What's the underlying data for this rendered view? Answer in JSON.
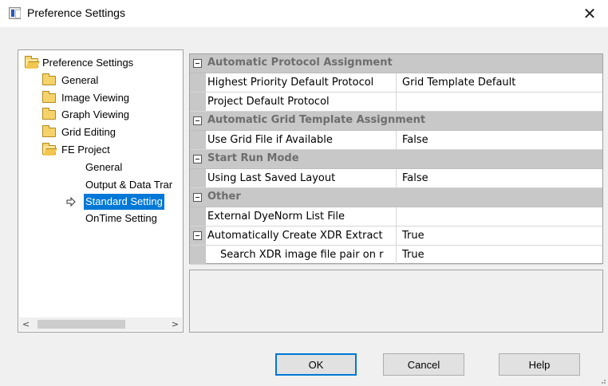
{
  "window": {
    "title": "Preference Settings",
    "close_glyph": "✕"
  },
  "tree": {
    "items": [
      {
        "label": "Preference Settings",
        "icon": "folder-open-icon"
      },
      {
        "label": "General",
        "icon": "folder-icon"
      },
      {
        "label": "Image Viewing",
        "icon": "folder-icon"
      },
      {
        "label": "Graph Viewing",
        "icon": "folder-icon"
      },
      {
        "label": "Grid Editing",
        "icon": "folder-icon"
      },
      {
        "label": "FE Project",
        "icon": "folder-open-icon"
      },
      {
        "label": "General",
        "icon": "none"
      },
      {
        "label": "Output & Data Trar",
        "icon": "none"
      },
      {
        "label": "Standard Setting",
        "icon": "arrow-icon",
        "selected": true
      },
      {
        "label": "OnTime Setting",
        "icon": "none"
      }
    ],
    "scroll_left": "<",
    "scroll_right": ">"
  },
  "property_grid": {
    "categories": [
      {
        "label": "Automatic Protocol Assignment",
        "properties": [
          {
            "name": "Highest Priority Default Protocol",
            "value": "Grid Template Default"
          },
          {
            "name": "Project Default Protocol",
            "value": ""
          }
        ]
      },
      {
        "label": "Automatic Grid Template Assignment",
        "properties": [
          {
            "name": "Use Grid File if Available",
            "value": "False"
          }
        ]
      },
      {
        "label": "Start Run Mode",
        "properties": [
          {
            "name": "Using Last Saved Layout",
            "value": "False"
          }
        ]
      },
      {
        "label": "Other",
        "properties": [
          {
            "name": "External DyeNorm List File",
            "value": ""
          },
          {
            "name": "Automatically Create XDR Extract",
            "value": "True",
            "expandable": true
          },
          {
            "name": "Search XDR image file pair on r",
            "value": "True",
            "child": true
          }
        ]
      }
    ]
  },
  "buttons": {
    "ok": "OK",
    "cancel": "Cancel",
    "help": "Help"
  },
  "colors": {
    "selection": "#0078d7",
    "category_band": "#c8c8c8",
    "category_text": "#6d6d6d"
  }
}
